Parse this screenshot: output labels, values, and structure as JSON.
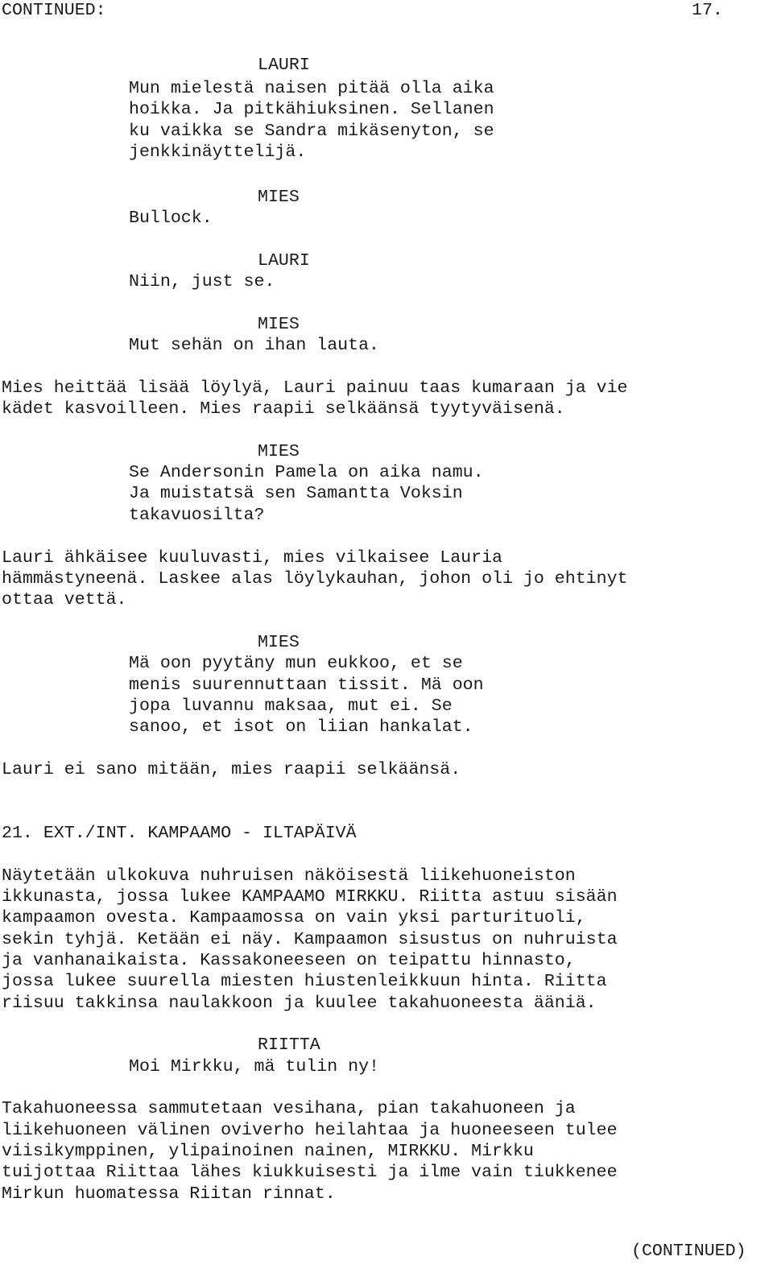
{
  "header": {
    "continued": "CONTINUED:",
    "page_number": "17."
  },
  "footer": {
    "continued": "(CONTINUED)"
  },
  "blocks": [
    {
      "type": "character",
      "text": "LAURI"
    },
    {
      "type": "dialogue",
      "lines": [
        "Mun mielestä naisen pitää olla aika",
        "hoikka. Ja pitkähiuksinen. Sellanen",
        "ku vaikka se Sandra mikäsenyton, se",
        "jenkkinäyttelijä."
      ]
    },
    {
      "type": "character",
      "text": "MIES"
    },
    {
      "type": "dialogue",
      "lines": [
        "Bullock."
      ]
    },
    {
      "type": "character",
      "text": "LAURI"
    },
    {
      "type": "dialogue",
      "lines": [
        "Niin, just se."
      ]
    },
    {
      "type": "character",
      "text": "MIES"
    },
    {
      "type": "dialogue",
      "lines": [
        "Mut sehän on ihan lauta."
      ]
    },
    {
      "type": "action",
      "lines": [
        "Mies heittää lisää löylyä, Lauri painuu taas kumaraan ja vie",
        "kädet kasvoilleen. Mies raapii selkäänsä tyytyväisenä."
      ]
    },
    {
      "type": "character",
      "text": "MIES"
    },
    {
      "type": "dialogue",
      "lines": [
        "Se Andersonin Pamela on aika namu.",
        "Ja muistatsä sen Samantta Voksin",
        "takavuosilta?"
      ]
    },
    {
      "type": "action",
      "lines": [
        "Lauri ähkäisee kuuluvasti, mies vilkaisee Lauria",
        "hämmästyneenä. Laskee alas löylykauhan, johon oli jo ehtinyt",
        "ottaa vettä."
      ]
    },
    {
      "type": "character",
      "text": "MIES"
    },
    {
      "type": "dialogue",
      "lines": [
        "Mä oon pyytäny mun eukkoo, et se",
        "menis suurennuttaan tissit. Mä oon",
        "jopa luvannu maksaa, mut ei. Se",
        "sanoo, et isot on liian hankalat."
      ]
    },
    {
      "type": "action",
      "lines": [
        "Lauri ei sano mitään, mies raapii selkäänsä."
      ]
    },
    {
      "type": "scene-heading",
      "text": "21. EXT./INT. KAMPAAMO - ILTAPÄIVÄ"
    },
    {
      "type": "action",
      "lines": [
        "Näytetään ulkokuva nuhruisen näköisestä liikehuoneiston",
        "ikkunasta, jossa lukee KAMPAAMO MIRKKU. Riitta astuu sisään",
        "kampaamon ovesta. Kampaamossa on vain yksi parturituoli,",
        "sekin tyhjä. Ketään ei näy. Kampaamon sisustus on nuhruista",
        "ja vanhanaikaista. Kassakoneeseen on teipattu hinnasto,",
        "jossa lukee suurella miesten hiustenleikkuun hinta. Riitta",
        "riisuu takkinsa naulakkoon ja kuulee takahuoneesta ääniä."
      ]
    },
    {
      "type": "character",
      "text": "RIITTA"
    },
    {
      "type": "dialogue",
      "lines": [
        "Moi Mirkku, mä tulin ny!"
      ]
    },
    {
      "type": "action",
      "lines": [
        "Takahuoneessa sammutetaan vesihana, pian takahuoneen ja",
        "liikehuoneen välinen oviverho heilahtaa ja huoneeseen tulee",
        "viisikymppinen, ylipainoinen nainen, MIRKKU. Mirkku",
        "tuijottaa Riittaa lähes kiukkuisesti ja ilme vain tiukkenee",
        "Mirkun huomatessa Riitan rinnat."
      ]
    }
  ]
}
